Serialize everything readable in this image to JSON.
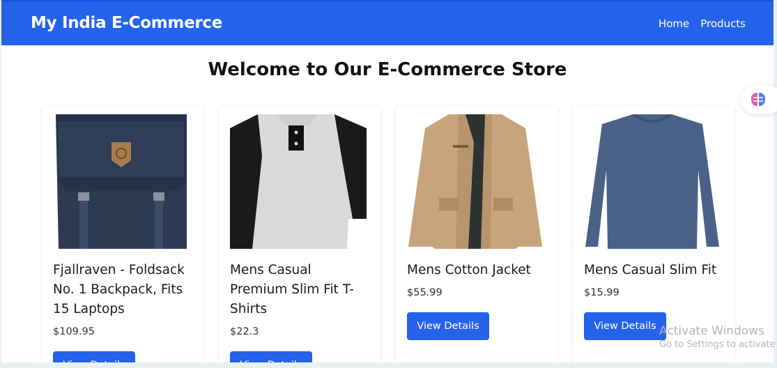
{
  "navbar": {
    "brand": "My India E-Commerce",
    "links": [
      "Home",
      "Products"
    ]
  },
  "page_title": "Welcome to Our E-Commerce Store",
  "products": [
    {
      "title": "Fjallraven - Foldsack No. 1 Backpack, Fits 15 Laptops",
      "price": "$109.95",
      "button": "View Details",
      "image": "backpack-image"
    },
    {
      "title": "Mens Casual Premium Slim Fit T-Shirts",
      "price": "$22.3",
      "button": "View Details",
      "image": "tshirt-image"
    },
    {
      "title": "Mens Cotton Jacket",
      "price": "$55.99",
      "button": "View Details",
      "image": "jacket-image"
    },
    {
      "title": "Mens Casual Slim Fit",
      "price": "$15.99",
      "button": "View Details",
      "image": "longsleeve-image"
    }
  ],
  "watermark": {
    "line1": "Activate Windows",
    "line2": "Go to Settings to activate"
  },
  "colors": {
    "primary": "#2563eb",
    "page_bg": "#ffffff",
    "frame_bg": "#e8f1f3"
  },
  "icons": {
    "assistant": "brain-icon"
  }
}
